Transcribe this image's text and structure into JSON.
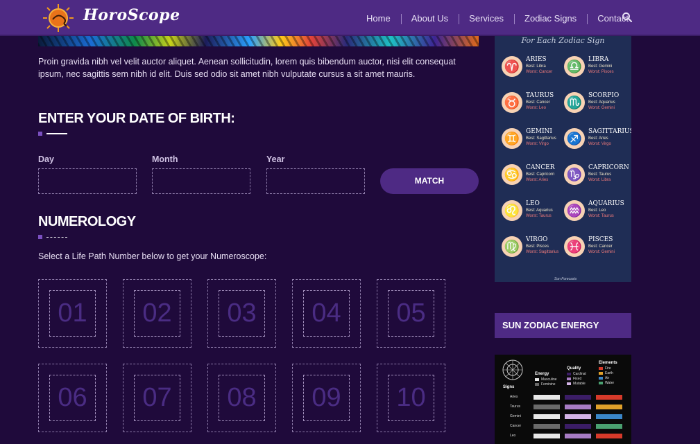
{
  "header": {
    "brand": "HoroScope",
    "menu": [
      "Home",
      "About Us",
      "Services",
      "Zodiac Signs",
      "Contact"
    ]
  },
  "intro_text": "Proin gravida nibh vel velit auctor aliquet. Aenean sollicitudin, lorem quis bibendum auctor, nisi elit consequat ipsum, nec sagittis sem nibh id elit. Duis sed odio sit amet nibh vulputate cursus a sit amet mauris.",
  "dob": {
    "heading": "ENTER YOUR DATE OF BIRTH:",
    "labels": {
      "day": "Day",
      "month": "Month",
      "year": "Year"
    },
    "values": {
      "day": "",
      "month": "",
      "year": ""
    },
    "match_label": "MATCH"
  },
  "numerology": {
    "heading": "NUMEROLOGY",
    "instruction": "Select a Life Path Number below to get your Numeroscope:",
    "numbers": [
      "01",
      "02",
      "03",
      "04",
      "05",
      "06",
      "07",
      "08",
      "09",
      "10"
    ]
  },
  "sidebar": {
    "zodiac_caption": "For Each Zodiac Sign",
    "zodiac_signature": "Sun Forecasts",
    "signs": [
      {
        "name": "ARIES",
        "glyph": "♈",
        "best": "Best: Libra",
        "worst": "Worst: Cancer"
      },
      {
        "name": "LIBRA",
        "glyph": "♎",
        "best": "Best: Gemini",
        "worst": "Worst: Pisces"
      },
      {
        "name": "TAURUS",
        "glyph": "♉",
        "best": "Best: Cancer",
        "worst": "Worst: Leo"
      },
      {
        "name": "SCORPIO",
        "glyph": "♏",
        "best": "Best: Aquarius",
        "worst": "Worst: Gemini"
      },
      {
        "name": "GEMINI",
        "glyph": "♊",
        "best": "Best: Sagittarius",
        "worst": "Worst: Virgo"
      },
      {
        "name": "SAGITTARIUS",
        "glyph": "♐",
        "best": "Best: Aries",
        "worst": "Worst: Virgo"
      },
      {
        "name": "CANCER",
        "glyph": "♋",
        "best": "Best: Capricorn",
        "worst": "Worst: Aries"
      },
      {
        "name": "CAPRICORN",
        "glyph": "♑",
        "best": "Best: Taurus",
        "worst": "Worst: Libra"
      },
      {
        "name": "LEO",
        "glyph": "♌",
        "best": "Best: Aquarius",
        "worst": "Worst: Taurus"
      },
      {
        "name": "AQUARIUS",
        "glyph": "♒",
        "best": "Best: Leo",
        "worst": "Worst: Taurus"
      },
      {
        "name": "VIRGO",
        "glyph": "♍",
        "best": "Best: Pisces",
        "worst": "Worst: Sagittarius"
      },
      {
        "name": "PISCES",
        "glyph": "♓",
        "best": "Best: Cancer",
        "worst": "Worst: Gemini"
      }
    ],
    "sun_heading": "SUN ZODIAC ENERGY",
    "energy_chart": {
      "signs_label": "Signs",
      "energy_label": "Energy",
      "quality_label": "Quality",
      "elements_label": "Elements",
      "energy_legend": [
        "Masculine",
        "Feminine"
      ],
      "quality_legend": [
        "Cardinal",
        "Fixed",
        "Mutable"
      ],
      "elements_legend": [
        "Fire",
        "Earth",
        "Air",
        "Water"
      ],
      "rows": [
        "Aries",
        "Taurus",
        "Gemini",
        "Cancer",
        "Leo"
      ],
      "colors": {
        "masculine": "#e8e8e8",
        "feminine": "#6a6a6a",
        "cardinal": "#3b1d66",
        "fixed": "#a77cc4",
        "mutable": "#d3b3e6",
        "fire": "#d63a2a",
        "earth": "#e0a02a",
        "air": "#3a86c8",
        "water": "#4aa070"
      }
    }
  }
}
